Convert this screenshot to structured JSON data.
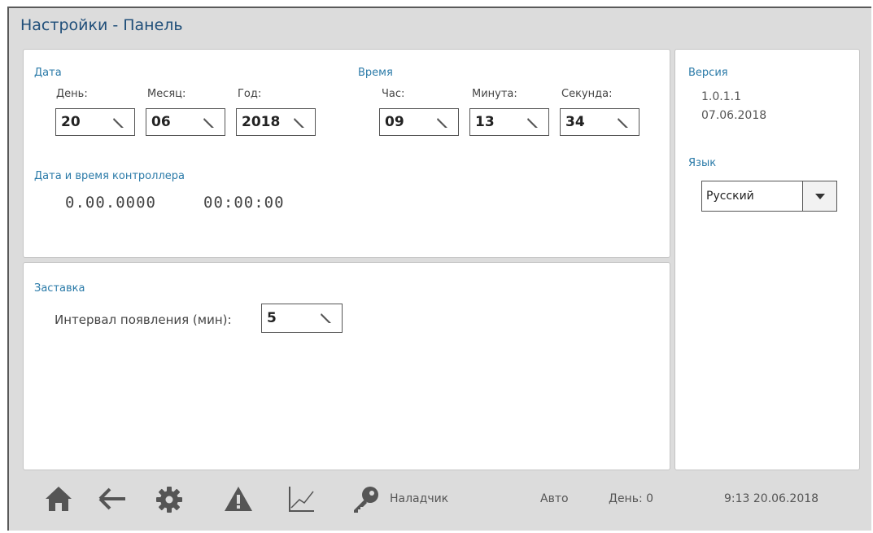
{
  "title": "Настройки - Панель",
  "date_section": {
    "label": "Дата",
    "day_label": "День:",
    "day_value": "20",
    "month_label": "Месяц:",
    "month_value": "06",
    "year_label": "Год:",
    "year_value": "2018"
  },
  "time_section": {
    "label": "Время",
    "hour_label": "Час:",
    "hour_value": "09",
    "minute_label": "Минута:",
    "minute_value": "13",
    "second_label": "Секунда:",
    "second_value": "34"
  },
  "controller": {
    "label": "Дата и время контроллера",
    "date": "0.00.0000",
    "time": "00:00:00"
  },
  "screensaver": {
    "label": "Заставка",
    "interval_label": "Интервал появления (мин):",
    "interval_value": "5"
  },
  "version": {
    "label": "Версия",
    "number": "1.0.1.1",
    "date": "07.06.2018"
  },
  "language": {
    "label": "Язык",
    "selected": "Русский"
  },
  "toolbar": {
    "user": "Наладчик",
    "mode": "Авто",
    "day_text": "День: 0",
    "clock": "9:13 20.06.2018"
  },
  "colors": {
    "title": "#1f4e79",
    "section_label": "#2a7aa8",
    "icon": "#555555",
    "background": "#dcdcdc"
  },
  "icons": [
    "home-icon",
    "back-arrow-icon",
    "gear-icon",
    "warning-icon",
    "chart-icon",
    "key-icon",
    "pencil-icon",
    "dropdown-arrow-icon"
  ]
}
